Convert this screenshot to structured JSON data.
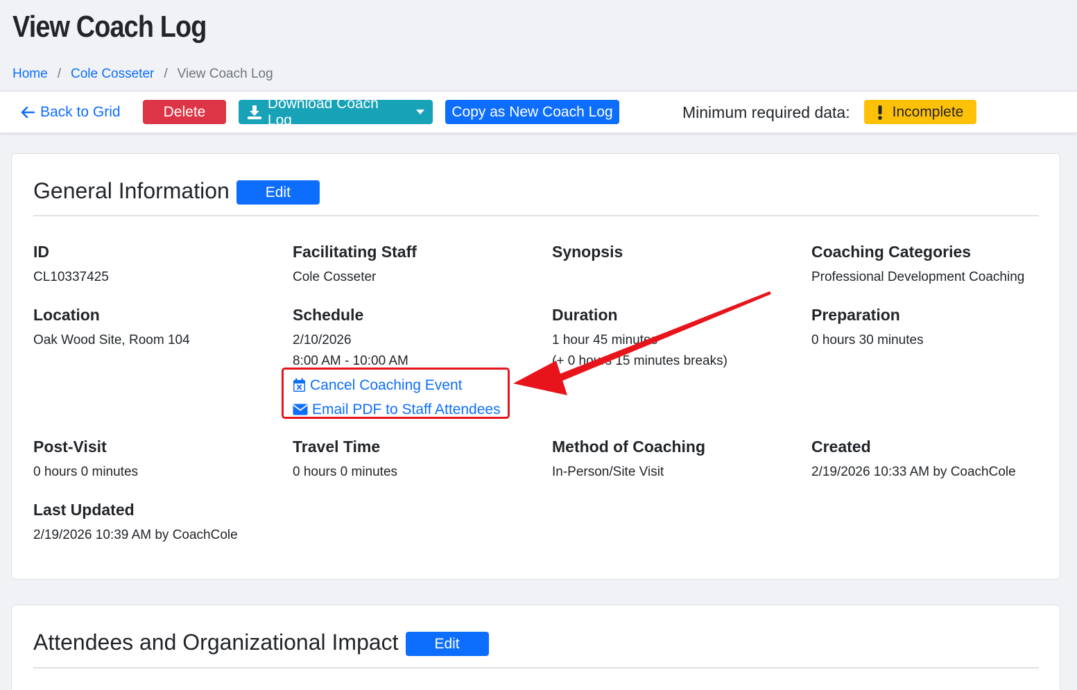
{
  "header": {
    "title": "View Coach Log",
    "breadcrumb": [
      {
        "label": "Home"
      },
      {
        "label": "Cole Cosseter"
      },
      {
        "label": "View Coach Log"
      }
    ],
    "separator": "/"
  },
  "toolbar": {
    "back_label": "Back to Grid",
    "delete_label": "Delete",
    "download_label": "Download Coach Log",
    "copy_label": "Copy as New Coach Log",
    "min_required_label": "Minimum required data:",
    "status_label": "Incomplete"
  },
  "general": {
    "title": "General Information",
    "edit_label": "Edit",
    "id_label": "ID",
    "id_value": "CL10337425",
    "staff_label": "Facilitating Staff",
    "staff_value": "Cole Cosseter",
    "synopsis_label": "Synopsis",
    "categories_label": "Coaching Categories",
    "categories_value": "Professional Development Coaching",
    "location_label": "Location",
    "location_value": "Oak Wood Site, Room 104",
    "schedule_label": "Schedule",
    "schedule_date": "2/10/2026",
    "schedule_time": "8:00 AM - 10:00 AM",
    "cancel_link": "Cancel Coaching Event",
    "email_link": "Email PDF to Staff Attendees",
    "duration_label": "Duration",
    "duration_value": "1 hour 45 minutes",
    "duration_breaks": "(+ 0 hours 15 minutes breaks)",
    "preparation_label": "Preparation",
    "preparation_value": "0 hours 30 minutes",
    "postvisit_label": "Post-Visit",
    "postvisit_value": "0 hours 0 minutes",
    "travel_label": "Travel Time",
    "travel_value": "0 hours 0 minutes",
    "method_label": "Method of Coaching",
    "method_value": "In-Person/Site Visit",
    "created_label": "Created",
    "created_value": "2/19/2026 10:33 AM by CoachCole",
    "updated_label": "Last Updated",
    "updated_value": "2/19/2026 10:39 AM by CoachCole"
  },
  "attendees": {
    "title": "Attendees and Organizational Impact",
    "edit_label": "Edit"
  },
  "colors": {
    "primary": "#0d6efd",
    "danger": "#dc3545",
    "info": "#17a2b8",
    "warning": "#ffc107",
    "annotation": "#e8141c"
  },
  "icons": {
    "back": "arrow-left-icon",
    "download": "download-icon",
    "status": "exclamation-icon",
    "cancel": "calendar-x-icon",
    "email": "envelope-icon"
  }
}
